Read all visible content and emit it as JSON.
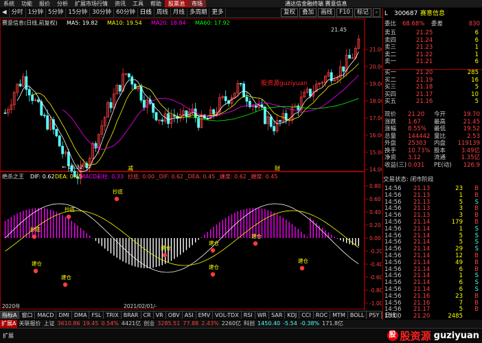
{
  "menu": {
    "items": [
      "系统",
      "功能",
      "报价",
      "分析",
      "扩展市场行情",
      "资讯",
      "工具",
      "帮助"
    ],
    "highlight": "股票池",
    "highlight2": "市场",
    "app_title": "通达信金融终端 赛意信息"
  },
  "toolbar": {
    "periods": [
      "分时",
      "1分钟",
      "5分钟",
      "15分钟",
      "30分钟",
      "60分钟",
      "日线",
      "周线",
      "月线",
      "多周期",
      "更多"
    ],
    "active_period": "日线",
    "right_buttons": [
      "复权",
      "叠加",
      "画线",
      "F10",
      "标记",
      "-"
    ]
  },
  "main_chart": {
    "header_title": "赛意信息(日线,前复权)",
    "ma5": "MA5: 19.82",
    "ma10": "MA10: 19.54",
    "ma20": "MA20: 18.84",
    "ma60": "MA60: 17.92",
    "high_label": "21.45",
    "low_label": "13.32",
    "watermark_text": "股资源guziyuan",
    "event_labels": [
      "减",
      "财"
    ],
    "price_axis": [
      "21.00",
      "20.00",
      "19.00",
      "18.00",
      "17.00",
      "16.00",
      "15.00",
      "14.00"
    ]
  },
  "macd_panel": {
    "header_title": "绝杀之王",
    "dif": "DIF: 0.62",
    "dea": "DEA: 0.45",
    "macd": "MACD彩柱: 0.33",
    "signals_line": "抄底: 0.00  _DIF: 0.62  _DEA: 0.45  _缠度: 0.62  _缠度: 0.45",
    "labels": [
      "抄底",
      "抄底",
      "抄底",
      "建仓",
      "建仓",
      "建仓",
      "建仓",
      "建仓",
      "建仓",
      "建仓"
    ],
    "axis": [
      "0.80",
      "0.60",
      "0.40",
      "0.20",
      "0.00",
      "-0.20",
      "-0.40",
      "-0.60",
      "-0.80",
      "-1.00"
    ]
  },
  "date_axis": [
    "2020年",
    "2021/02/01/-"
  ],
  "bottom_tabs": [
    "指标A",
    "窗口",
    "MACD",
    "DMI",
    "DMA",
    "FSL",
    "TRIX",
    "BRAR",
    "CR",
    "VR",
    "OBV",
    "ASI",
    "EMV",
    "VOL-TDX",
    "RSI",
    "WR",
    "SAR",
    "KDJ",
    "CCI",
    "ROC",
    "MTM",
    "BOLL",
    "PSY"
  ],
  "bottom_tabs2": [
    "扩展A",
    "关联报价"
  ],
  "bottom_right_tab": "日线",
  "index_bar": [
    {
      "name": "上证",
      "value": "3610.86",
      "change": "19.45",
      "pct": "0.54%",
      "amount": "4421亿"
    },
    {
      "name": "创业",
      "value": "3285.51",
      "change": "77.88",
      "pct": "2.43%",
      "amount": "2260亿"
    },
    {
      "name": "科创",
      "value": "1450.40",
      "change": "-5.54",
      "pct": "-0.38%",
      "amount": "171.8亿"
    }
  ],
  "quote": {
    "code": "300687",
    "name": "赛意信息",
    "wb_label": "委比",
    "wb_value": "68.68%",
    "wc_label": "委差",
    "wc_value": "830",
    "asks": [
      {
        "label": "卖五",
        "price": "21.25",
        "vol": "6"
      },
      {
        "label": "卖四",
        "price": "21.24",
        "vol": "6"
      },
      {
        "label": "卖三",
        "price": "21.23",
        "vol": "1"
      },
      {
        "label": "卖二",
        "price": "21.22",
        "vol": "1"
      },
      {
        "label": "卖一",
        "price": "21.21",
        "vol": "6"
      }
    ],
    "bids": [
      {
        "label": "买一",
        "price": "21.20",
        "vol": "285"
      },
      {
        "label": "买二",
        "price": "21.19",
        "vol": "16"
      },
      {
        "label": "买三",
        "price": "21.18",
        "vol": "5"
      },
      {
        "label": "买四",
        "price": "21.17",
        "vol": "10"
      },
      {
        "label": "买五",
        "price": "21.16",
        "vol": "5"
      }
    ],
    "stats": [
      {
        "l1": "现价",
        "v1": "21.20",
        "l2": "今开",
        "v2": "19.70"
      },
      {
        "l1": "涨跌",
        "v1": "1.67",
        "l2": "最高",
        "v2": "21.45"
      },
      {
        "l1": "涨幅",
        "v1": "8.55%",
        "l2": "最低",
        "v2": "19.52"
      },
      {
        "l1": "总量",
        "v1": "144442",
        "l2": "量比",
        "v2": "2.53"
      },
      {
        "l1": "外盘",
        "v1": "25303",
        "l2": "内盘",
        "v2": "119139"
      },
      {
        "l1": "换手",
        "v1": "10.73%",
        "l2": "股本",
        "v2": "3.49亿"
      },
      {
        "l1": "净资",
        "v1": "3.12",
        "l2": "流通",
        "v2": "1.35亿"
      },
      {
        "l1": "收益(三)",
        "v1": "0.031",
        "l2": "PE(动)",
        "v2": "126.9"
      }
    ],
    "trade_status": "交易状态: 闭市阶段",
    "ticks": [
      {
        "t": "14:56",
        "p": "21.13",
        "v": "23",
        "s": "B"
      },
      {
        "t": "14:56",
        "p": "21.13",
        "v": "1",
        "s": "B"
      },
      {
        "t": "14:56",
        "p": "21.13",
        "v": "5",
        "s": "S"
      },
      {
        "t": "14:56",
        "p": "21.13",
        "v": "3",
        "s": "B"
      },
      {
        "t": "14:56",
        "p": "21.13",
        "v": "3",
        "s": "B"
      },
      {
        "t": "14:56",
        "p": "21.14",
        "v": "179",
        "s": "B"
      },
      {
        "t": "14:56",
        "p": "21.14",
        "v": "1",
        "s": "S"
      },
      {
        "t": "14:56",
        "p": "21.14",
        "v": "5",
        "s": "S"
      },
      {
        "t": "14:56",
        "p": "21.14",
        "v": "5",
        "s": "S"
      },
      {
        "t": "14:56",
        "p": "21.14",
        "v": "29",
        "s": "S"
      },
      {
        "t": "14:56",
        "p": "21.14",
        "v": "12",
        "s": "B"
      },
      {
        "t": "14:56",
        "p": "21.14",
        "v": "49",
        "s": "B"
      },
      {
        "t": "14:56",
        "p": "21.14",
        "v": "6",
        "s": "B"
      },
      {
        "t": "14:56",
        "p": "21.14",
        "v": "1",
        "s": "S"
      },
      {
        "t": "14:56",
        "p": "21.14",
        "v": "6",
        "s": "S"
      },
      {
        "t": "14:56",
        "p": "21.14",
        "v": "6",
        "s": "S"
      },
      {
        "t": "14:56",
        "p": "21.16",
        "v": "23",
        "s": "B"
      },
      {
        "t": "14:56",
        "p": "21.16",
        "v": "7",
        "s": "B"
      },
      {
        "t": "14:56",
        "p": "21.17",
        "v": "5",
        "s": "B"
      },
      {
        "t": "15:00",
        "p": "21.20",
        "v": "2485",
        "s": ""
      }
    ]
  },
  "status_bar": {
    "item1": "扩展"
  },
  "brand": {
    "cn": "股资源",
    "en": "guziyuan"
  },
  "colors": {
    "up": "#ff3c3c",
    "down": "#54ffff",
    "accent": "#ff0000",
    "yellow": "#ffff00",
    "macd_pos": "#ff00ff",
    "macd_neg": "#ffffff"
  }
}
